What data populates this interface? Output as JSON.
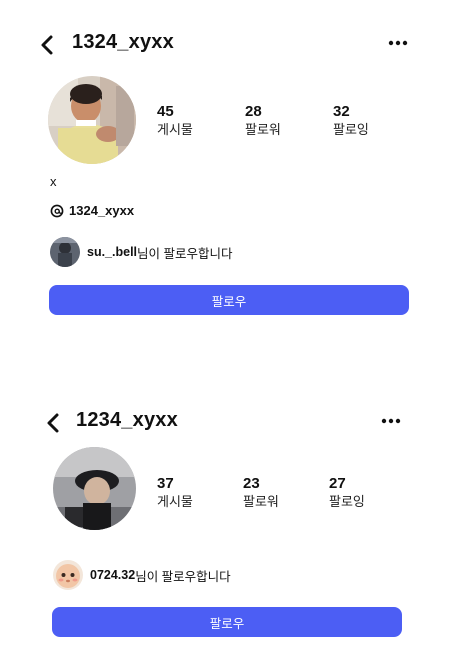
{
  "profiles": [
    {
      "username": "1324_xyxx",
      "stats": [
        {
          "value": "45",
          "label": "게시물"
        },
        {
          "value": "28",
          "label": "팔로워"
        },
        {
          "value": "32",
          "label": "팔로잉"
        }
      ],
      "bio": "x",
      "threads_handle": "1324_xyxx",
      "followed_by": {
        "name": "su._.bell",
        "suffix": "님이 팔로우합니다"
      },
      "follow_button": "팔로우",
      "icons": [
        "chevron-left-icon",
        "more-horizontal-icon",
        "threads-icon"
      ]
    },
    {
      "username": "1234_xyxx",
      "stats": [
        {
          "value": "37",
          "label": "게시물"
        },
        {
          "value": "23",
          "label": "팔로워"
        },
        {
          "value": "27",
          "label": "팔로잉"
        }
      ],
      "followed_by": {
        "name": "0724.32",
        "suffix": "님이 팔로우합니다"
      },
      "follow_button": "팔로우",
      "icons": [
        "chevron-left-icon",
        "more-horizontal-icon"
      ]
    }
  ],
  "colors": {
    "follow_button": "#4c5ef4",
    "follow_button_text": "#ffffff",
    "text": "#111111",
    "background": "#ffffff"
  }
}
